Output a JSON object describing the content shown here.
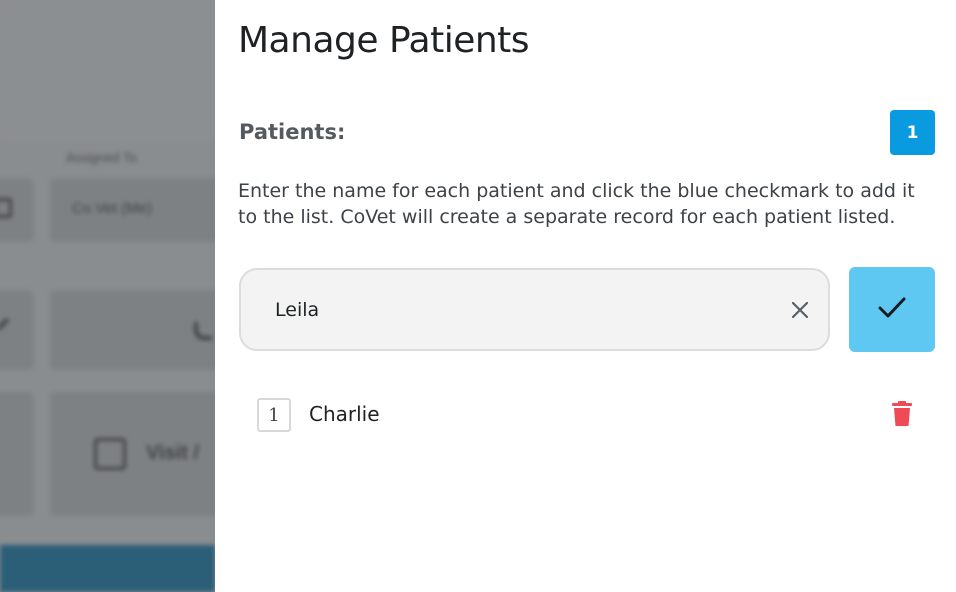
{
  "background_app": {
    "assigned_label": "Assigned To",
    "assignee_value": "Co Vet (Me)",
    "visit_label": "Visit /"
  },
  "drawer": {
    "title": "Manage Patients",
    "patients_label": "Patients:",
    "patient_count": "1",
    "instructions": "Enter the name for each patient and click the blue checkmark to add it to the list. CoVet will create a separate record for each patient listed.",
    "name_input_value": "Leila",
    "patients": [
      {
        "index": "1",
        "name": "Charlie"
      }
    ]
  },
  "colors": {
    "count_badge": "#0a9ae0",
    "confirm_button": "#5ec8f2",
    "delete_icon": "#ef4a55",
    "background_bottom_bar": "#2b5f78"
  },
  "icons": {
    "clear": "close-icon",
    "confirm": "checkmark-icon",
    "delete": "trash-icon"
  }
}
